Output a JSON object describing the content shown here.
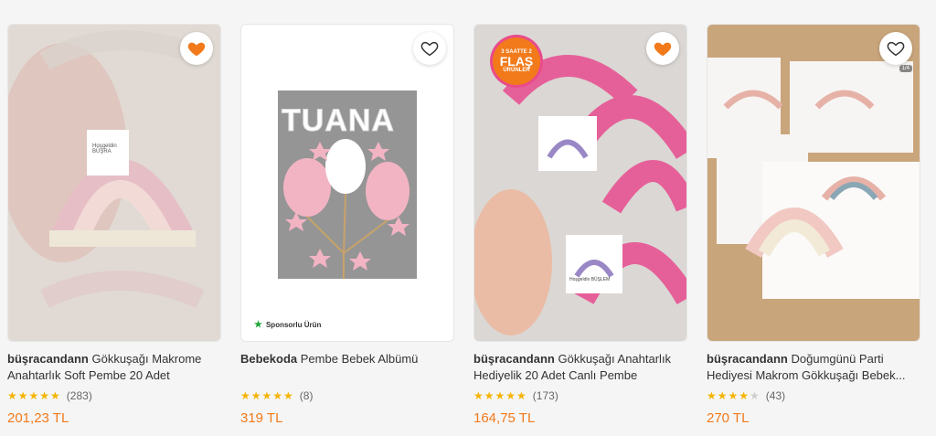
{
  "products": [
    {
      "brand": "büşracandann",
      "name": "Gökkuşağı Makrome Anahtarlık Soft Pembe 20 Adet",
      "rating_stars": 4.5,
      "review_count": "(283)",
      "price": "201,23 TL",
      "favorite": true,
      "image_text": "Hoşgeldin BÜŞRA"
    },
    {
      "brand": "Bebekoda",
      "name": "Pembe Bebek Albümü",
      "rating_stars": 5,
      "review_count": "(8)",
      "price": "319 TL",
      "favorite": false,
      "image_text": "TUANA",
      "sponsor_label": "Sponsorlu Ürün"
    },
    {
      "brand": "büşracandann",
      "name": "Gökkuşağı Anahtarlık Hediyelik 20 Adet Canlı Pembe",
      "rating_stars": 4.5,
      "review_count": "(173)",
      "price": "164,75 TL",
      "favorite": true,
      "flash_badge": {
        "line1": "3 SAATTE 2",
        "line2": "FLAŞ",
        "line3": "ÜRÜNLER"
      },
      "image_text": "Hoşgeldin BÜŞLEM"
    },
    {
      "brand": "büşracandann",
      "name": "Doğumgünü Parti Hediyesi Makrom Gökkuşağı Bebek...",
      "rating_stars": 4,
      "review_count": "(43)",
      "price": "270 TL",
      "favorite": false,
      "image_badge": "1/4"
    }
  ],
  "colors": {
    "accent_orange": "#f27a1a",
    "star_yellow": "#f5b400",
    "sponsor_green": "#1ea53a"
  },
  "icons": {
    "favorite": "heart-icon",
    "star": "star-icon"
  }
}
